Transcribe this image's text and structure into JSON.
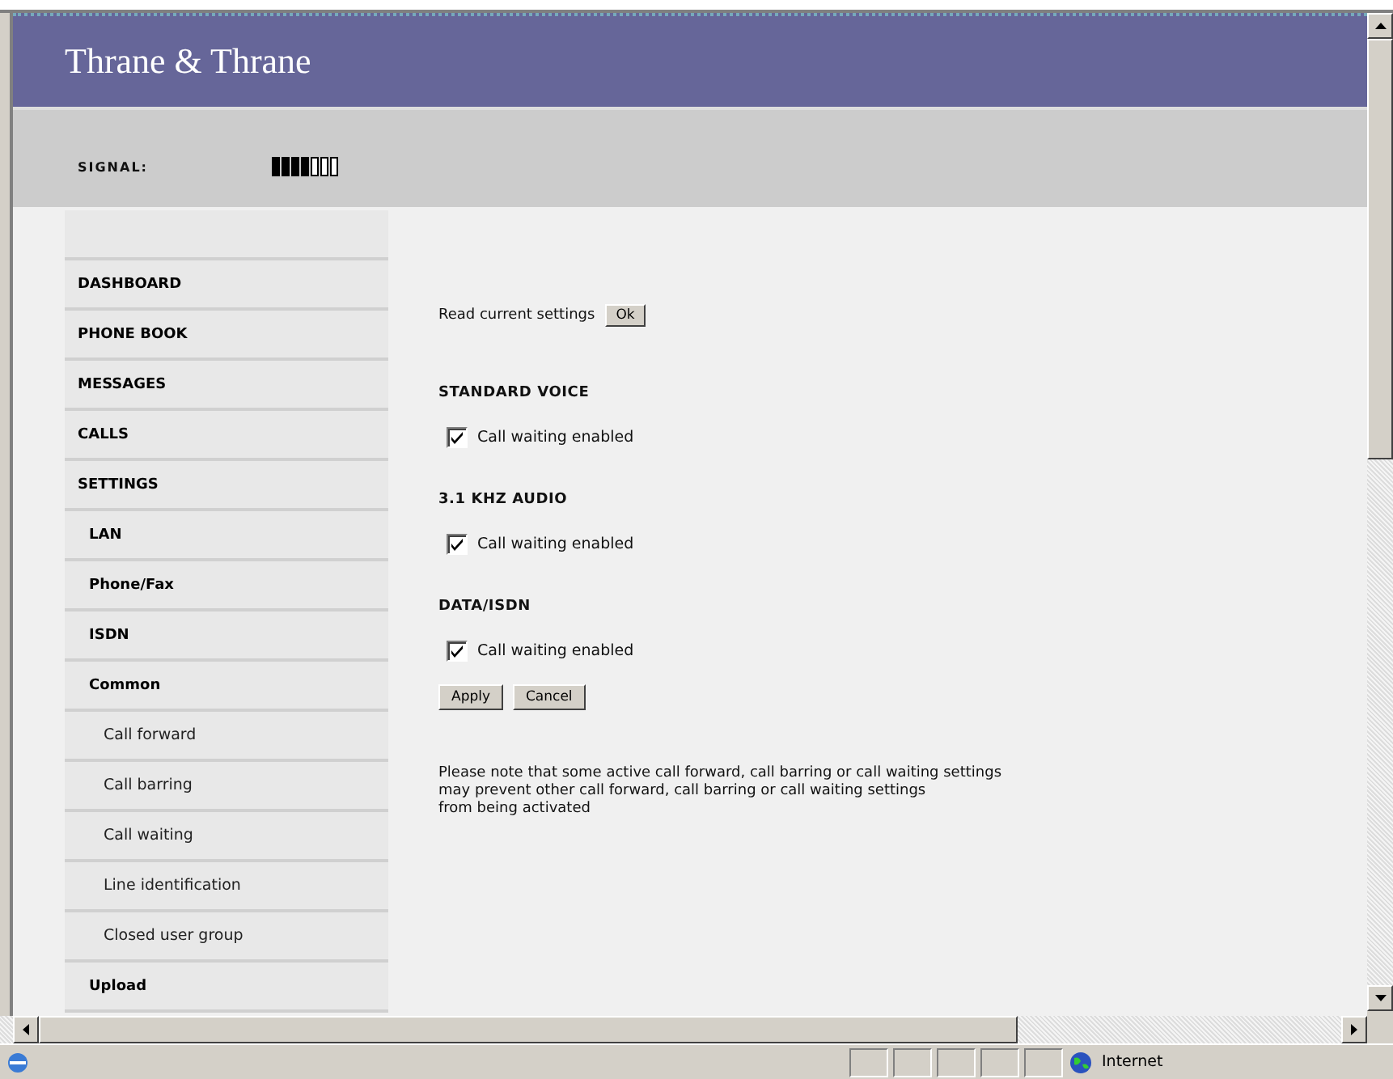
{
  "header": {
    "logo": "Thrane & Thrane",
    "signal_label": "SIGNAL:",
    "signal": {
      "level": 0.571
    }
  },
  "sidebar": {
    "items": [
      {
        "label": "DASHBOARD"
      },
      {
        "label": "PHONE BOOK"
      },
      {
        "label": "MESSAGES"
      },
      {
        "label": "CALLS"
      },
      {
        "label": "SETTINGS",
        "children": [
          {
            "label": "LAN"
          },
          {
            "label": "Phone/Fax"
          },
          {
            "label": "ISDN"
          },
          {
            "label": "Common",
            "children": [
              {
                "label": "Call forward"
              },
              {
                "label": "Call barring"
              },
              {
                "label": "Call waiting"
              },
              {
                "label": "Line identification"
              },
              {
                "label": "Closed user group"
              }
            ]
          },
          {
            "label": "Upload"
          }
        ]
      }
    ]
  },
  "content": {
    "read_label": "Read current settings",
    "read_button": "Ok",
    "sections": [
      {
        "title": "STANDARD VOICE",
        "option": "Call waiting enabled",
        "checked": true
      },
      {
        "title": "3.1 KHZ AUDIO",
        "option": "Call waiting enabled",
        "checked": true
      },
      {
        "title": "DATA/ISDN",
        "option": "Call waiting enabled",
        "checked": true
      }
    ],
    "buttons": [
      "Apply",
      "Cancel"
    ],
    "note": "Please note that some active call forward, call barring or call waiting settings\nmay prevent other call forward, call barring or call waiting settings\nfrom being activated"
  },
  "status_bar": {
    "zone": "Internet"
  }
}
